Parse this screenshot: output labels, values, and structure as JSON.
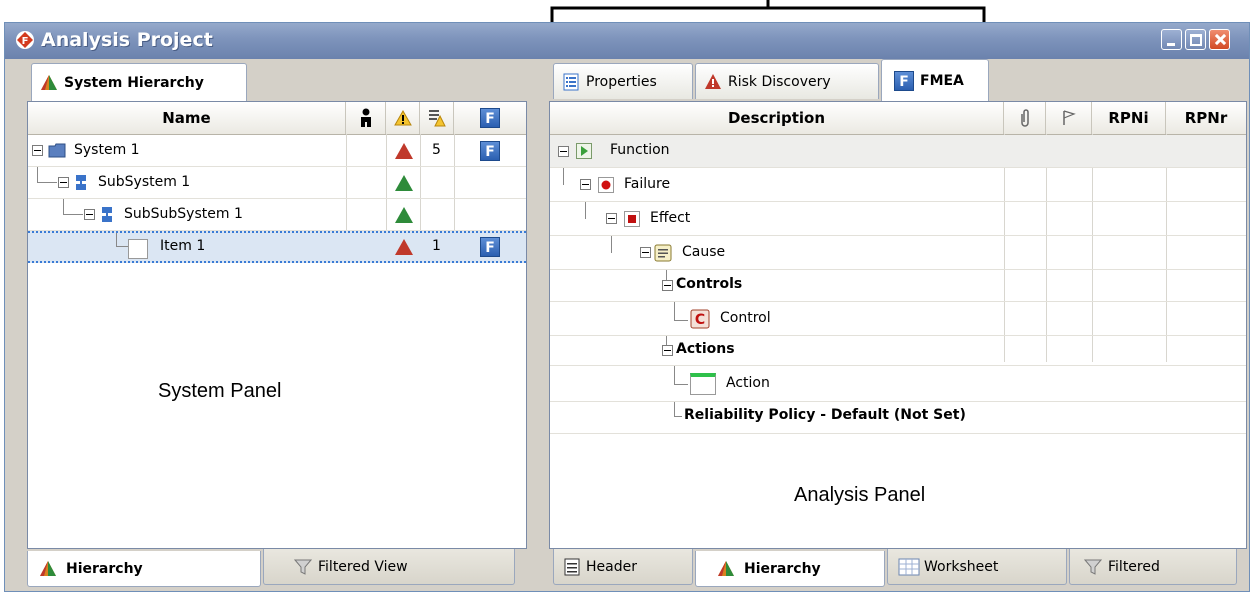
{
  "window": {
    "title": "Analysis Project"
  },
  "system_panel": {
    "tab_label": "System Hierarchy",
    "columns": {
      "name": "Name"
    },
    "rows": [
      {
        "label": "System 1",
        "risk_color": "#c0392b",
        "count": "5",
        "fmea": "F"
      },
      {
        "label": "SubSystem 1",
        "risk_color": "#2e8b3a",
        "count": "",
        "fmea": ""
      },
      {
        "label": "SubSubSystem 1",
        "risk_color": "#2e8b3a",
        "count": "",
        "fmea": ""
      },
      {
        "label": "Item 1",
        "risk_color": "#c0392b",
        "count": "1",
        "fmea": "F"
      }
    ],
    "annotation": "System Panel",
    "bottom_tabs": [
      "Hierarchy",
      "Filtered View"
    ]
  },
  "analysis_panel": {
    "tabs": [
      "Properties",
      "Risk Discovery",
      "FMEA"
    ],
    "columns": {
      "description": "Description",
      "rpni": "RPNi",
      "rpnr": "RPNr"
    },
    "rows": [
      {
        "label": "Function"
      },
      {
        "label": "Failure"
      },
      {
        "label": "Effect"
      },
      {
        "label": "Cause"
      },
      {
        "label": "Controls"
      },
      {
        "label": "Control"
      },
      {
        "label": "Actions"
      },
      {
        "label": "Action"
      },
      {
        "label": "Reliability Policy - Default (Not Set)"
      }
    ],
    "annotation": "Analysis Panel",
    "bottom_tabs": [
      "Header",
      "Hierarchy",
      "Worksheet",
      "Filtered"
    ]
  },
  "colors": {
    "titlebar": "#7d93bb",
    "close_button": "#d24a25",
    "fmea_icon": "#2b5fb0",
    "selected_row": "#dbe6f3"
  }
}
